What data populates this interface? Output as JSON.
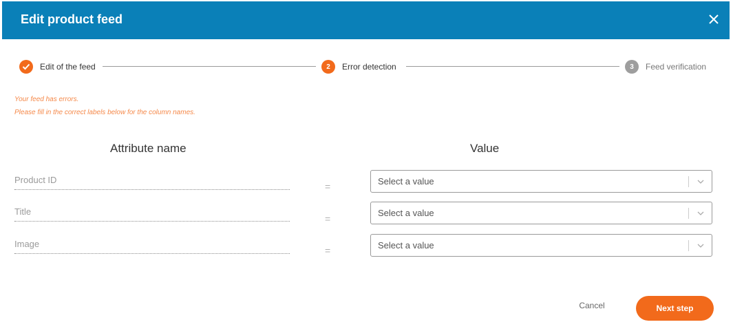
{
  "dialog": {
    "title": "Edit product feed",
    "header_color": "#0a80b8",
    "close_icon": "close-icon"
  },
  "stepper": {
    "steps": [
      {
        "label": "Edit of the feed",
        "state": "completed",
        "icon": "check-icon"
      },
      {
        "label": "Error detection",
        "state": "active",
        "number": "2"
      },
      {
        "label": "Feed verification",
        "state": "pending",
        "number": "3"
      }
    ],
    "accent_color": "#f26a1b"
  },
  "error": {
    "line1": "Your feed has errors.",
    "line2": "Please fill in the correct labels below for the column names.",
    "color": "#f5894a"
  },
  "mapping": {
    "attribute_header": "Attribute name",
    "value_header": "Value",
    "equals_sign": "=",
    "rows": [
      {
        "attribute": "Product ID",
        "placeholder": "Select a value"
      },
      {
        "attribute": "Title",
        "placeholder": "Select a value"
      },
      {
        "attribute": "Image",
        "placeholder": "Select a value"
      }
    ]
  },
  "footer": {
    "cancel_label": "Cancel",
    "next_label": "Next step"
  }
}
